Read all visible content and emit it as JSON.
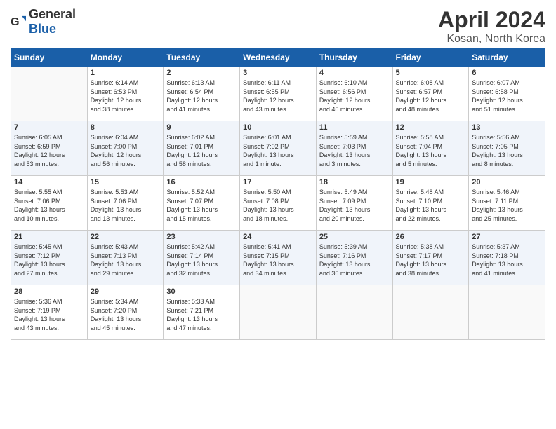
{
  "header": {
    "logo_general": "General",
    "logo_blue": "Blue",
    "month": "April 2024",
    "location": "Kosan, North Korea"
  },
  "weekdays": [
    "Sunday",
    "Monday",
    "Tuesday",
    "Wednesday",
    "Thursday",
    "Friday",
    "Saturday"
  ],
  "weeks": [
    [
      {
        "day": "",
        "info": ""
      },
      {
        "day": "1",
        "info": "Sunrise: 6:14 AM\nSunset: 6:53 PM\nDaylight: 12 hours\nand 38 minutes."
      },
      {
        "day": "2",
        "info": "Sunrise: 6:13 AM\nSunset: 6:54 PM\nDaylight: 12 hours\nand 41 minutes."
      },
      {
        "day": "3",
        "info": "Sunrise: 6:11 AM\nSunset: 6:55 PM\nDaylight: 12 hours\nand 43 minutes."
      },
      {
        "day": "4",
        "info": "Sunrise: 6:10 AM\nSunset: 6:56 PM\nDaylight: 12 hours\nand 46 minutes."
      },
      {
        "day": "5",
        "info": "Sunrise: 6:08 AM\nSunset: 6:57 PM\nDaylight: 12 hours\nand 48 minutes."
      },
      {
        "day": "6",
        "info": "Sunrise: 6:07 AM\nSunset: 6:58 PM\nDaylight: 12 hours\nand 51 minutes."
      }
    ],
    [
      {
        "day": "7",
        "info": "Sunrise: 6:05 AM\nSunset: 6:59 PM\nDaylight: 12 hours\nand 53 minutes."
      },
      {
        "day": "8",
        "info": "Sunrise: 6:04 AM\nSunset: 7:00 PM\nDaylight: 12 hours\nand 56 minutes."
      },
      {
        "day": "9",
        "info": "Sunrise: 6:02 AM\nSunset: 7:01 PM\nDaylight: 12 hours\nand 58 minutes."
      },
      {
        "day": "10",
        "info": "Sunrise: 6:01 AM\nSunset: 7:02 PM\nDaylight: 13 hours\nand 1 minute."
      },
      {
        "day": "11",
        "info": "Sunrise: 5:59 AM\nSunset: 7:03 PM\nDaylight: 13 hours\nand 3 minutes."
      },
      {
        "day": "12",
        "info": "Sunrise: 5:58 AM\nSunset: 7:04 PM\nDaylight: 13 hours\nand 5 minutes."
      },
      {
        "day": "13",
        "info": "Sunrise: 5:56 AM\nSunset: 7:05 PM\nDaylight: 13 hours\nand 8 minutes."
      }
    ],
    [
      {
        "day": "14",
        "info": "Sunrise: 5:55 AM\nSunset: 7:06 PM\nDaylight: 13 hours\nand 10 minutes."
      },
      {
        "day": "15",
        "info": "Sunrise: 5:53 AM\nSunset: 7:06 PM\nDaylight: 13 hours\nand 13 minutes."
      },
      {
        "day": "16",
        "info": "Sunrise: 5:52 AM\nSunset: 7:07 PM\nDaylight: 13 hours\nand 15 minutes."
      },
      {
        "day": "17",
        "info": "Sunrise: 5:50 AM\nSunset: 7:08 PM\nDaylight: 13 hours\nand 18 minutes."
      },
      {
        "day": "18",
        "info": "Sunrise: 5:49 AM\nSunset: 7:09 PM\nDaylight: 13 hours\nand 20 minutes."
      },
      {
        "day": "19",
        "info": "Sunrise: 5:48 AM\nSunset: 7:10 PM\nDaylight: 13 hours\nand 22 minutes."
      },
      {
        "day": "20",
        "info": "Sunrise: 5:46 AM\nSunset: 7:11 PM\nDaylight: 13 hours\nand 25 minutes."
      }
    ],
    [
      {
        "day": "21",
        "info": "Sunrise: 5:45 AM\nSunset: 7:12 PM\nDaylight: 13 hours\nand 27 minutes."
      },
      {
        "day": "22",
        "info": "Sunrise: 5:43 AM\nSunset: 7:13 PM\nDaylight: 13 hours\nand 29 minutes."
      },
      {
        "day": "23",
        "info": "Sunrise: 5:42 AM\nSunset: 7:14 PM\nDaylight: 13 hours\nand 32 minutes."
      },
      {
        "day": "24",
        "info": "Sunrise: 5:41 AM\nSunset: 7:15 PM\nDaylight: 13 hours\nand 34 minutes."
      },
      {
        "day": "25",
        "info": "Sunrise: 5:39 AM\nSunset: 7:16 PM\nDaylight: 13 hours\nand 36 minutes."
      },
      {
        "day": "26",
        "info": "Sunrise: 5:38 AM\nSunset: 7:17 PM\nDaylight: 13 hours\nand 38 minutes."
      },
      {
        "day": "27",
        "info": "Sunrise: 5:37 AM\nSunset: 7:18 PM\nDaylight: 13 hours\nand 41 minutes."
      }
    ],
    [
      {
        "day": "28",
        "info": "Sunrise: 5:36 AM\nSunset: 7:19 PM\nDaylight: 13 hours\nand 43 minutes."
      },
      {
        "day": "29",
        "info": "Sunrise: 5:34 AM\nSunset: 7:20 PM\nDaylight: 13 hours\nand 45 minutes."
      },
      {
        "day": "30",
        "info": "Sunrise: 5:33 AM\nSunset: 7:21 PM\nDaylight: 13 hours\nand 47 minutes."
      },
      {
        "day": "",
        "info": ""
      },
      {
        "day": "",
        "info": ""
      },
      {
        "day": "",
        "info": ""
      },
      {
        "day": "",
        "info": ""
      }
    ]
  ]
}
